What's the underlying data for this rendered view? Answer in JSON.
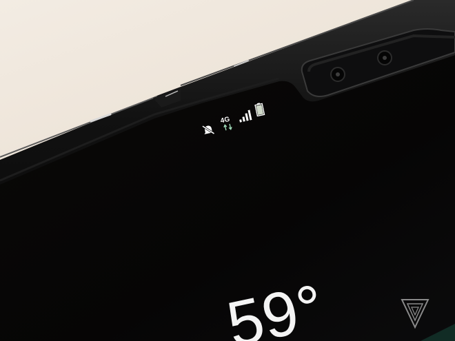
{
  "photo": {
    "subject": "foldable-phone-top-edge",
    "colors": {
      "background": "#efe6db",
      "device_frame": "#0b0b0b",
      "screen": "#050505",
      "status_icons": "#ffffff",
      "battery_fill": "#cfd8c8"
    }
  },
  "status_bar": {
    "icons": [
      "mute-icon",
      "network-type",
      "data-arrows-icon",
      "signal-icon",
      "battery-icon"
    ],
    "network": "4G"
  },
  "screen": {
    "temperature": "59°"
  },
  "watermark": {
    "icon": "the-verge-logo-icon"
  }
}
